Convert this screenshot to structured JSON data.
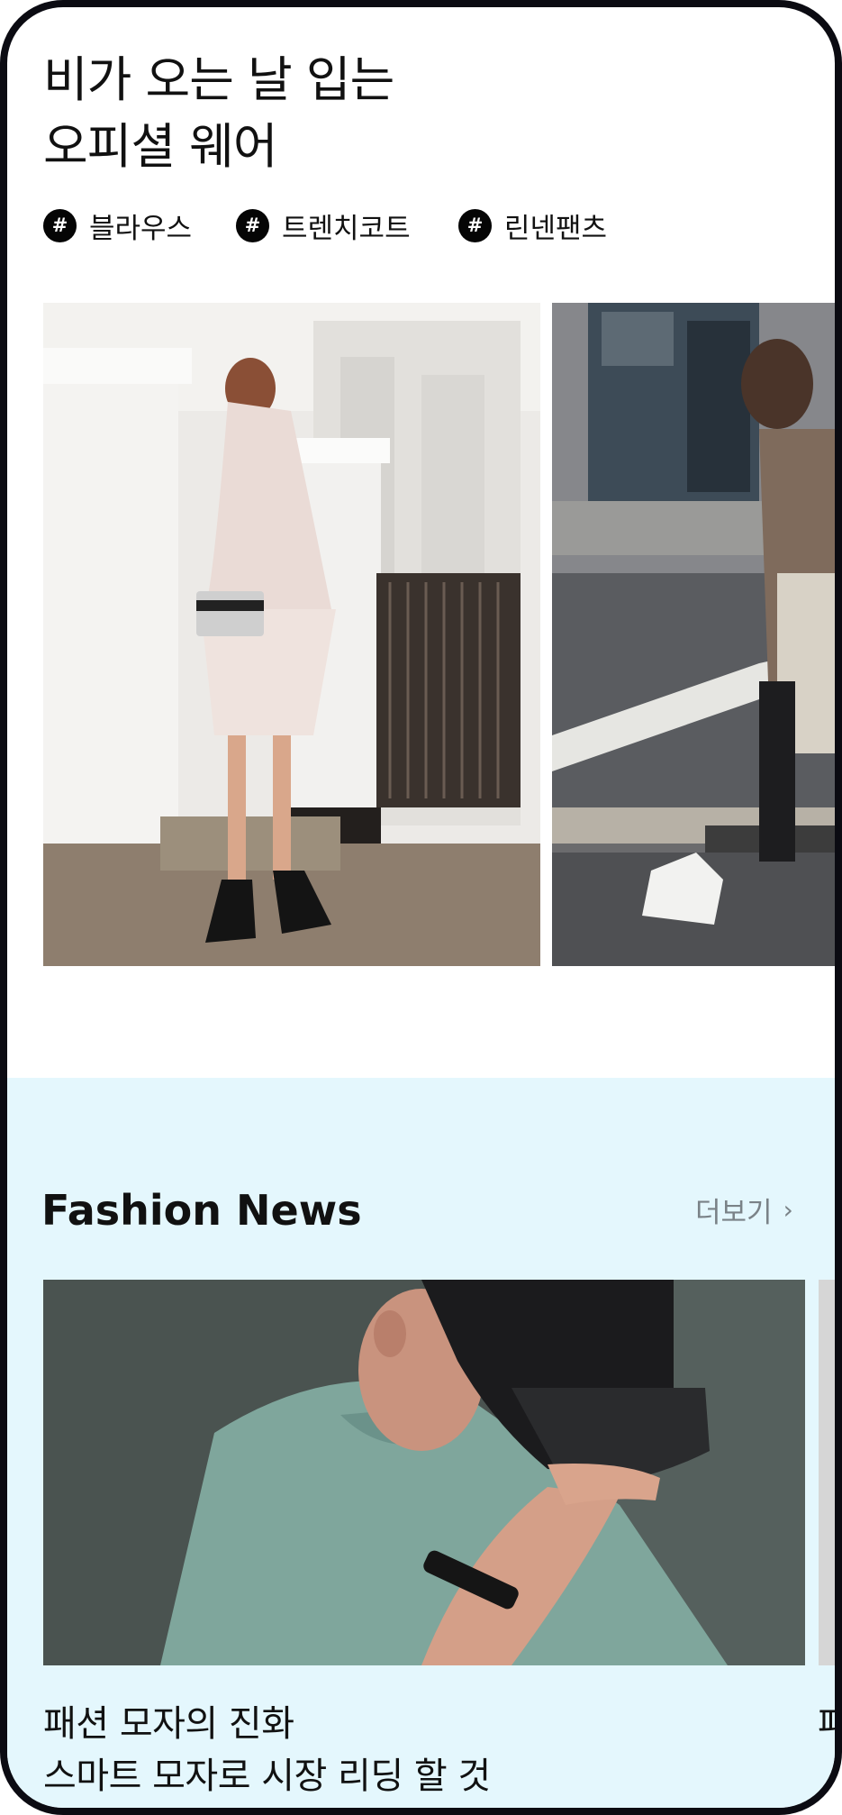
{
  "rainy_section": {
    "title_line1": "비가 오는 날 입는",
    "title_line2": "오피셜 웨어",
    "hash_symbol": "#",
    "tags": [
      "블라우스",
      "트렌치코트",
      "린넨팬츠"
    ]
  },
  "news_section": {
    "title": "Fashion News",
    "more_label": "더보기",
    "more_icon": "chevron-right-icon",
    "article_caption_line1": "패션 모자의 진화",
    "article_caption_line2": "스마트 모자로 시장 리딩 할 것",
    "peek_caption": "패"
  },
  "colors": {
    "news_background": "#e4f7fd",
    "hash_badge": "#050505",
    "more_text": "#7a8287"
  }
}
